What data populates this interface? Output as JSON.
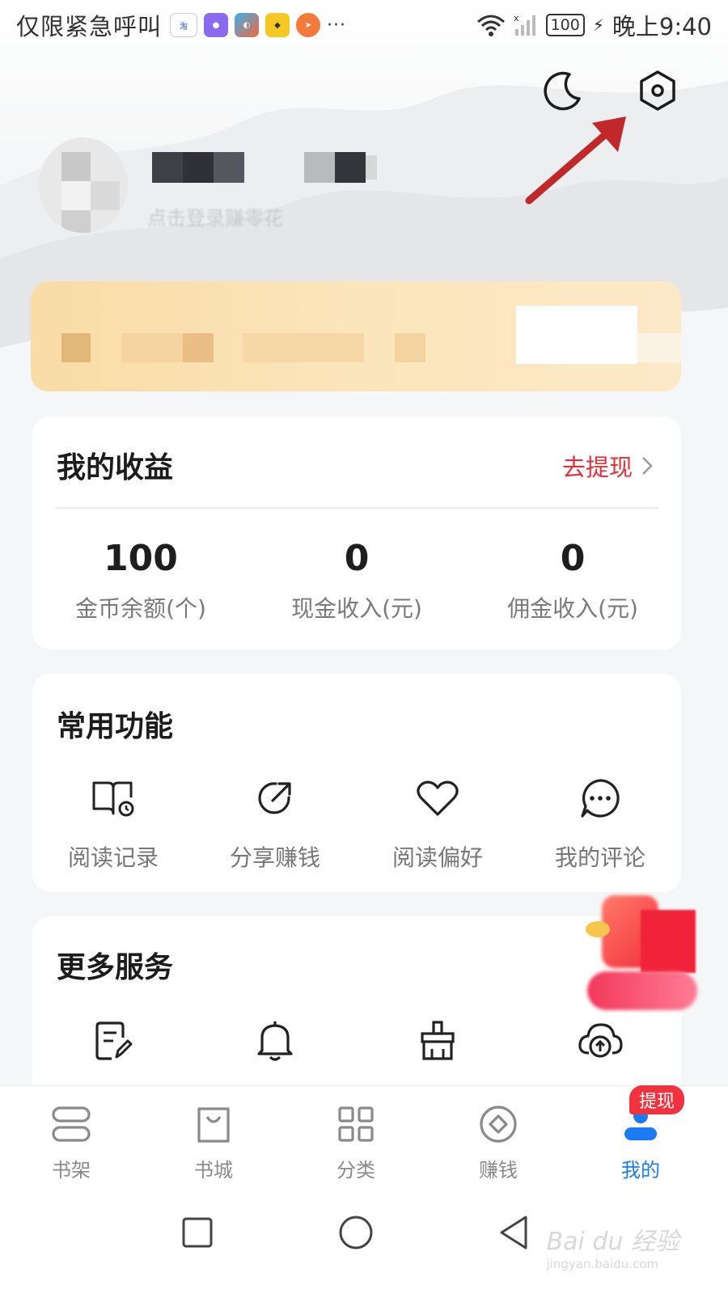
{
  "status_bar": {
    "left_text": "仅限紧急呼叫",
    "app_icons": [
      "taobao-app-icon",
      "purple-app-icon",
      "colorful-app-icon",
      "yellow-bird-app-icon",
      "orange-app-icon"
    ],
    "more": "···",
    "battery": "100",
    "time": "晚上9:40"
  },
  "header": {
    "night_mode_icon": "moon-icon",
    "settings_icon": "settings-hexagon-icon",
    "profile_subtitle": "点击登录赚零花"
  },
  "earnings": {
    "title": "我的收益",
    "withdraw_label": "去提现",
    "stats": [
      {
        "value": "100",
        "label": "金币余额(个)"
      },
      {
        "value": "0",
        "label": "现金收入(元)"
      },
      {
        "value": "0",
        "label": "佣金收入(元)"
      }
    ]
  },
  "common_functions": {
    "title": "常用功能",
    "items": [
      {
        "label": "阅读记录",
        "icon": "book-history-icon"
      },
      {
        "label": "分享赚钱",
        "icon": "share-icon"
      },
      {
        "label": "阅读偏好",
        "icon": "heart-icon"
      },
      {
        "label": "我的评论",
        "icon": "comment-icon"
      }
    ]
  },
  "more_services": {
    "title": "更多服务",
    "items": [
      {
        "icon": "document-edit-icon"
      },
      {
        "icon": "bell-icon"
      },
      {
        "icon": "clean-brush-icon"
      },
      {
        "icon": "cloud-upload-icon"
      }
    ]
  },
  "bottom_nav": {
    "items": [
      {
        "label": "书架",
        "icon": "bookshelf-icon"
      },
      {
        "label": "书城",
        "icon": "bookstore-bag-icon"
      },
      {
        "label": "分类",
        "icon": "category-grid-icon"
      },
      {
        "label": "赚钱",
        "icon": "earn-coin-icon"
      },
      {
        "label": "我的",
        "icon": "profile-icon",
        "active": true
      }
    ],
    "badge": "提现"
  },
  "watermark": {
    "main": "Bai du 经验",
    "sub": "jingyan.baidu.com"
  },
  "colors": {
    "accent_red": "#e0303a",
    "active_blue": "#1a7bf2",
    "vip_gold": "#f9dca6"
  }
}
